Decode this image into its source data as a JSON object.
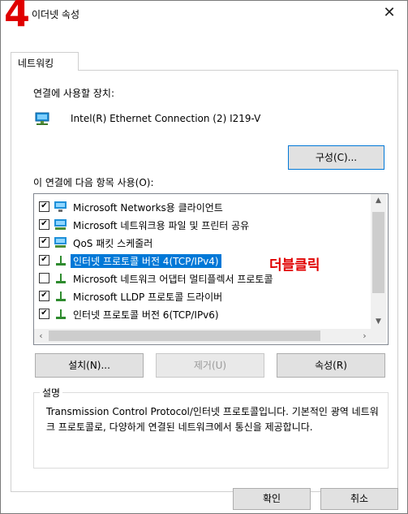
{
  "window": {
    "title": "이더넷 속성",
    "close_symbol": "✕",
    "step_marker": "4"
  },
  "tabs": [
    {
      "label": "네트워킹"
    }
  ],
  "networking": {
    "connect_using_label": "연결에 사용할 장치:",
    "device_name": "Intel(R) Ethernet Connection (2) I219-V",
    "configure_button": "구성(C)...",
    "items_label": "이 연결에 다음 항목 사용(O):",
    "items": [
      {
        "label": "Microsoft Networks용 클라이언트",
        "checked": true,
        "icon": "network-client-icon"
      },
      {
        "label": "Microsoft 네트워크용 파일 및 프린터 공유",
        "checked": true,
        "icon": "network-service-icon"
      },
      {
        "label": "QoS 패킷 스케줄러",
        "checked": true,
        "icon": "network-service-icon"
      },
      {
        "label": "인터넷 프로토콜 버전 4(TCP/IPv4)",
        "checked": true,
        "selected": true,
        "icon": "protocol-icon"
      },
      {
        "label": "Microsoft 네트워크 어댑터 멀티플렉서 프로토콜",
        "checked": false,
        "icon": "protocol-icon"
      },
      {
        "label": "Microsoft LLDP 프로토콜 드라이버",
        "checked": true,
        "icon": "protocol-icon"
      },
      {
        "label": "인터넷 프로토콜 버전 6(TCP/IPv6)",
        "checked": true,
        "icon": "protocol-icon"
      }
    ],
    "annotation": "더블클릭",
    "install_button": "설치(N)...",
    "uninstall_button": "제거(U)",
    "properties_button": "속성(R)",
    "description_group": "설명",
    "description_text": "Transmission Control Protocol/인터넷 프로토콜입니다. 기본적인 광역 네트워크 프로토콜로, 다양하게 연결된 네트워크에서 통신을 제공합니다."
  },
  "footer": {
    "ok_button": "확인",
    "cancel_button": "취소"
  },
  "colors": {
    "selection": "#0078d7",
    "annotation": "#e00000"
  }
}
